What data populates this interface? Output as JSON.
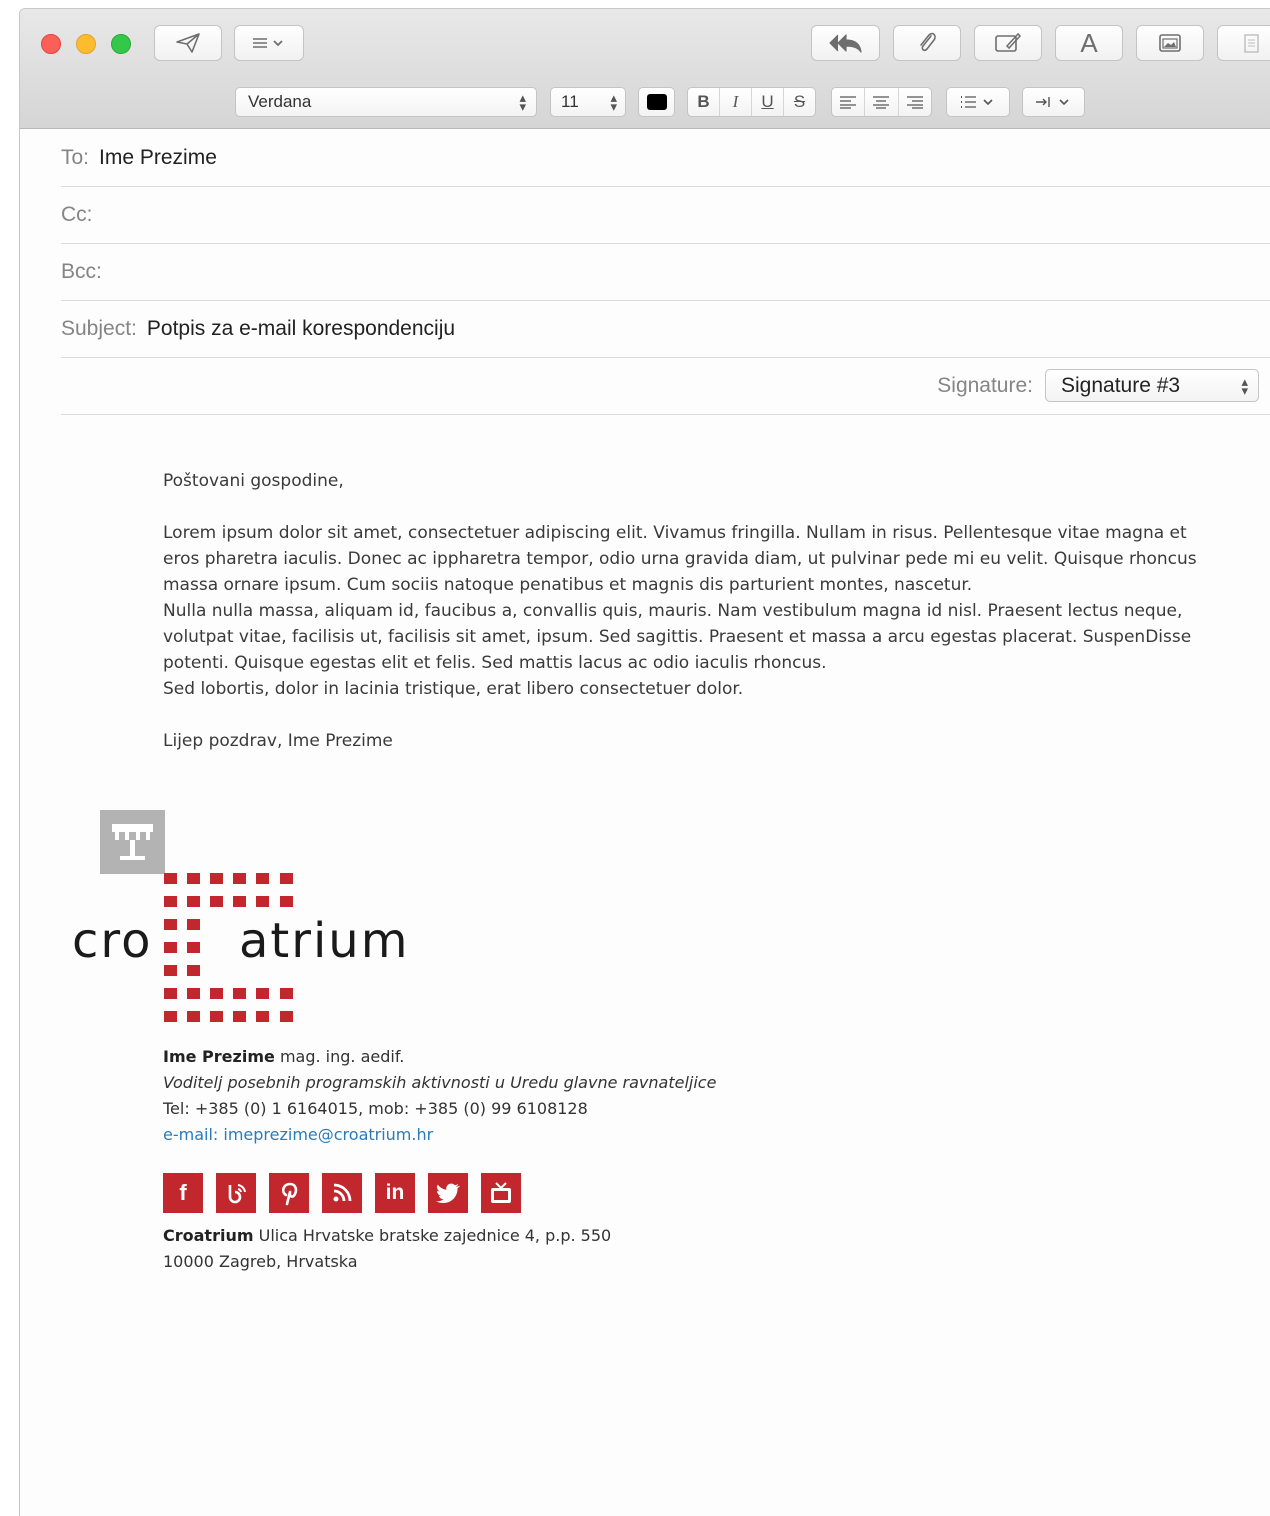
{
  "toolbar": {
    "font_name": "Verdana",
    "font_size": "11",
    "buttons": [
      "send",
      "list",
      "reply-all",
      "attach",
      "markup",
      "format",
      "photo",
      "stationery"
    ],
    "text_color": "#000000",
    "fmt_bold": "B",
    "fmt_italic": "I",
    "fmt_underline": "U",
    "fmt_strike": "S",
    "format_letter": "A"
  },
  "headers": {
    "to_label": "To:",
    "to_value": "Ime Prezime",
    "cc_label": "Cc:",
    "bcc_label": "Bcc:",
    "subject_label": "Subject:",
    "subject_value": "Potpis za e-mail korespondenciju",
    "signature_label": "Signature:",
    "signature_value": "Signature #3"
  },
  "body": {
    "greeting": "Poštovani gospodine,",
    "paragraph1": "Lorem ipsum dolor sit amet, consectetuer adipiscing elit. Vivamus fringilla. Nullam in risus. Pellentesque vitae magna et eros pharetra iaculis. Donec ac ippharetra tempor, odio urna gravida diam, ut pulvinar pede mi eu velit. Quisque rhoncus massa ornare ipsum. Cum sociis natoque penatibus et magnis dis parturient montes, nascetur.",
    "paragraph2": "Nulla nulla massa, aliquam id, faucibus a, convallis quis, mauris. Nam vestibulum magna id nisl. Praesent lectus neque, volutpat vitae, facilisis ut, facilisis sit amet, ipsum. Sed sagittis. Praesent et massa a arcu egestas placerat. SuspenDisse potenti. Quisque egestas elit et felis. Sed mattis lacus ac odio iaculis rhoncus.",
    "paragraph3": "Sed lobortis, dolor in lacinia tristique, erat libero consectetuer dolor.",
    "closing": "Lijep pozdrav, Ime Prezime"
  },
  "signature": {
    "logo_left": "cro",
    "logo_right": "atrium",
    "brand_color": "#c2272d",
    "name": "Ime Prezime",
    "title_suffix": "mag. ing. aedif.",
    "position": "Voditelj posebnih programskih aktivnosti u Uredu glavne ravnateljice",
    "phone": "Tel: +385 (0) 1 6164015, mob: +385 (0) 99 6108128",
    "email": "e-mail: imeprezime@croatrium.hr",
    "social": [
      "f",
      "blog",
      "p",
      "rss",
      "in",
      "twitter",
      "tv"
    ],
    "company": "Croatrium",
    "address1": "Ulica Hrvatske bratske zajednice 4, p.p. 550",
    "address2": "10000 Zagreb, Hrvatska"
  }
}
